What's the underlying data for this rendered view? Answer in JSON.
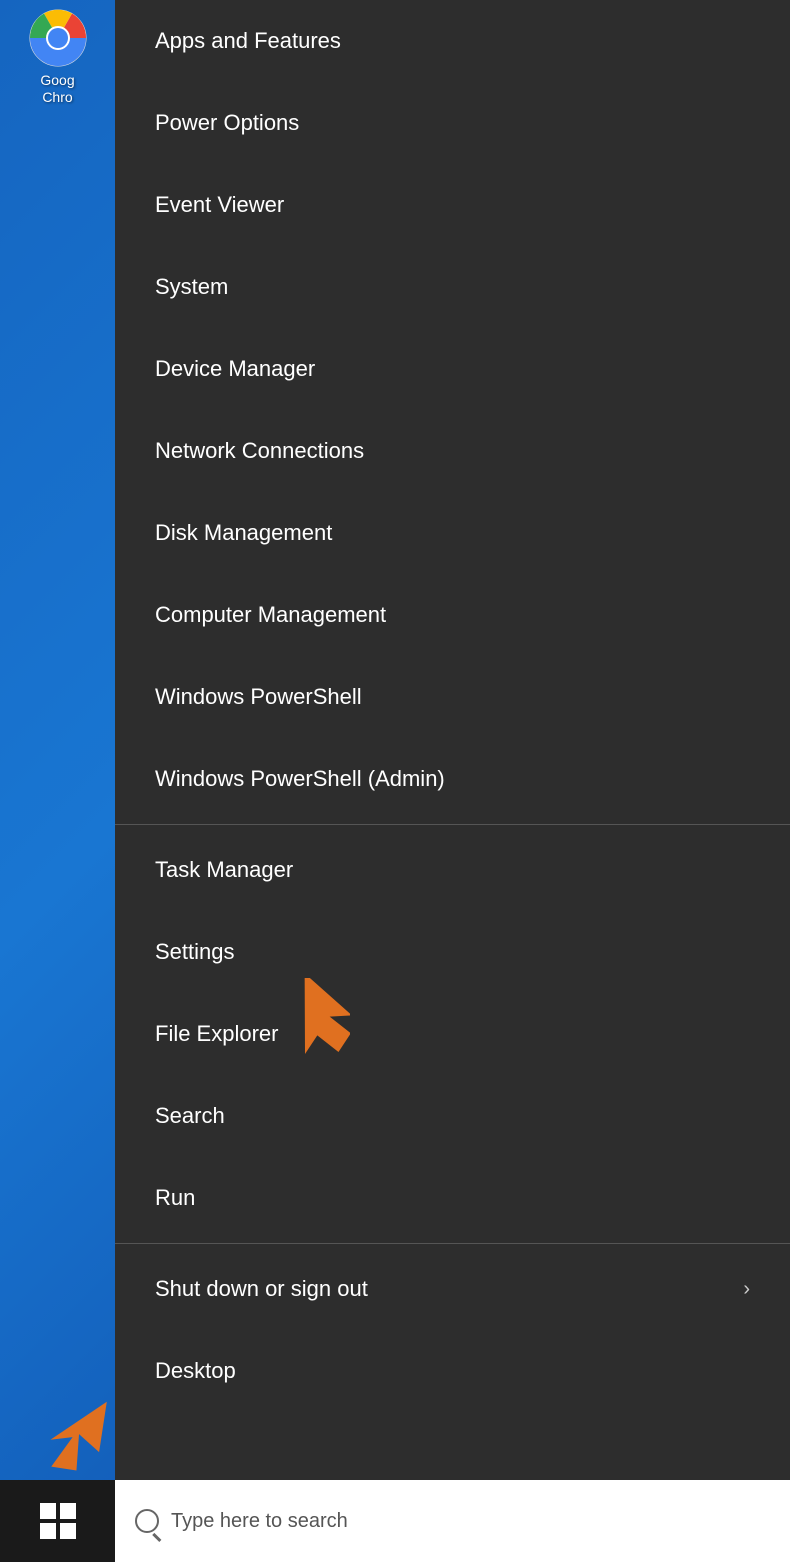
{
  "desktop": {
    "chrome_label_line1": "Goog",
    "chrome_label_line2": "Chro"
  },
  "context_menu": {
    "items": [
      {
        "id": "apps-and-features",
        "label": "Apps and Features",
        "has_arrow": false,
        "has_divider_after": false
      },
      {
        "id": "power-options",
        "label": "Power Options",
        "has_arrow": false,
        "has_divider_after": false
      },
      {
        "id": "event-viewer",
        "label": "Event Viewer",
        "has_arrow": false,
        "has_divider_after": false
      },
      {
        "id": "system",
        "label": "System",
        "has_arrow": false,
        "has_divider_after": false
      },
      {
        "id": "device-manager",
        "label": "Device Manager",
        "has_arrow": false,
        "has_divider_after": false
      },
      {
        "id": "network-connections",
        "label": "Network Connections",
        "has_arrow": false,
        "has_divider_after": false
      },
      {
        "id": "disk-management",
        "label": "Disk Management",
        "has_arrow": false,
        "has_divider_after": false
      },
      {
        "id": "computer-management",
        "label": "Computer Management",
        "has_arrow": false,
        "has_divider_after": false
      },
      {
        "id": "windows-powershell",
        "label": "Windows PowerShell",
        "has_arrow": false,
        "has_divider_after": false
      },
      {
        "id": "windows-powershell-admin",
        "label": "Windows PowerShell (Admin)",
        "has_arrow": false,
        "has_divider_after": true
      },
      {
        "id": "task-manager",
        "label": "Task Manager",
        "has_arrow": false,
        "has_divider_after": false
      },
      {
        "id": "settings",
        "label": "Settings",
        "has_arrow": false,
        "has_divider_after": false
      },
      {
        "id": "file-explorer",
        "label": "File Explorer",
        "has_arrow": false,
        "has_divider_after": false
      },
      {
        "id": "search",
        "label": "Search",
        "has_arrow": false,
        "has_divider_after": false
      },
      {
        "id": "run",
        "label": "Run",
        "has_arrow": false,
        "has_divider_after": true
      },
      {
        "id": "shut-down-or-sign-out",
        "label": "Shut down or sign out",
        "has_arrow": true,
        "has_divider_after": false
      },
      {
        "id": "desktop",
        "label": "Desktop",
        "has_arrow": false,
        "has_divider_after": false
      }
    ]
  },
  "taskbar": {
    "search_placeholder": "Type here to search"
  }
}
